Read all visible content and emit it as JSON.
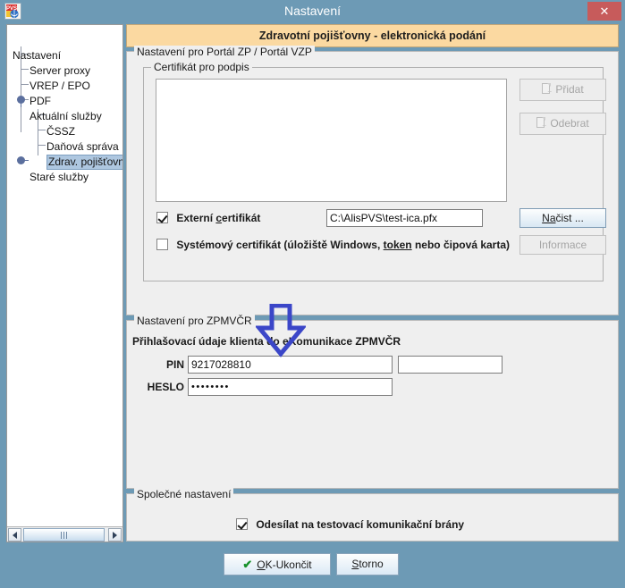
{
  "window": {
    "title": "Nastavení",
    "app_icon": "pvs-logo-icon",
    "close_label": "✕"
  },
  "sidebar": {
    "nodes": [
      {
        "label": "Nastavení",
        "level": 0,
        "selected": false,
        "handle": "none"
      },
      {
        "label": "Server proxy",
        "level": 1,
        "selected": false,
        "handle": "none"
      },
      {
        "label": "VREP / EPO",
        "level": 1,
        "selected": false,
        "handle": "none"
      },
      {
        "label": "PDF",
        "level": 1,
        "selected": false,
        "handle": "none"
      },
      {
        "label": "Aktuální služby",
        "level": 1,
        "selected": false,
        "handle": "expanded"
      },
      {
        "label": "ČSSZ",
        "level": 2,
        "selected": false,
        "handle": "none"
      },
      {
        "label": "Daňová správa",
        "level": 2,
        "selected": false,
        "handle": "none"
      },
      {
        "label": "Zdrav. pojišťovn",
        "level": 2,
        "selected": true,
        "handle": "none"
      },
      {
        "label": "Staré služby",
        "level": 1,
        "selected": false,
        "handle": "collapsed"
      }
    ]
  },
  "banner": {
    "title": "Zdravotní pojišťovny - elektronická podání"
  },
  "portal_panel": {
    "title": "Nastavení pro Portál ZP / Portál VZP",
    "cert_group": {
      "title": "Certifikát pro podpis",
      "list_items": [],
      "add_button": "Přidat",
      "remove_button": "Odebrat",
      "external_cert": {
        "label": "Externí certifikát",
        "checked": true,
        "path_value": "C:\\AlisPVS\\test-ica.pfx",
        "load_button": "Načíst ..."
      },
      "system_cert": {
        "label": "Systémový certifikát (úložiště Windows, token nebo čipová karta)",
        "checked": false,
        "info_button": "Informace"
      }
    }
  },
  "zpmvcr_panel": {
    "title": "Nastavení pro ZPMVČR",
    "subtitle": "Přihlašovací údaje klienta do eKomunikace ZPMVČR",
    "fields": [
      {
        "label": "PIN",
        "value": "9217028810",
        "masked": false
      },
      {
        "label": "HESLO",
        "value": "••••••••",
        "masked": true
      }
    ],
    "extra_field_value": ""
  },
  "common_panel": {
    "title": "Společné nastavení",
    "test_gateway": {
      "label": "Odesílat na testovací komunikační brány",
      "checked": true
    }
  },
  "footer": {
    "ok_label": "OK-Ukončit",
    "ok_mnemonic": "O",
    "cancel_label": "Storno",
    "cancel_mnemonic": "S"
  },
  "annotation": {
    "arrow": "down-arrow-annotation",
    "color": "#3b46c8"
  },
  "colors": {
    "window_frame": "#6d9ab5",
    "banner_bg": "#fbd9a1",
    "panel_bg": "#efefef",
    "selection": "#aec7e0",
    "close_btn": "#c75b5b",
    "arrow": "#3b46c8"
  }
}
